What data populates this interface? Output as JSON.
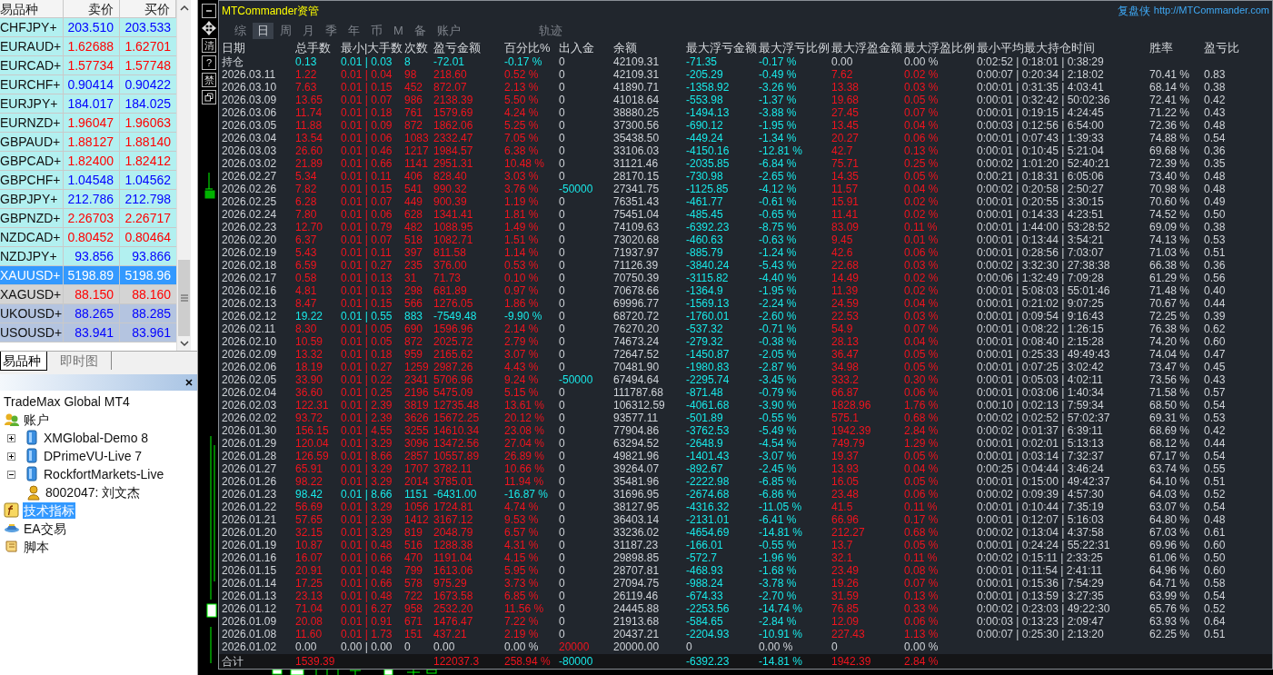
{
  "market_watch": {
    "columns": [
      "易品种",
      "卖价",
      "买价"
    ],
    "rows": [
      {
        "symbol": "CHFJPY+",
        "bid": "203.510",
        "ask": "203.533",
        "selected": false,
        "color": "#b2f0f0",
        "falling": false
      },
      {
        "symbol": "EURAUD+",
        "bid": "1.62688",
        "ask": "1.62701",
        "selected": false,
        "color": "#b2f0f0",
        "falling": true
      },
      {
        "symbol": "EURCAD+",
        "bid": "1.57734",
        "ask": "1.57748",
        "selected": false,
        "color": "#b2f0f0",
        "falling": true
      },
      {
        "symbol": "EURCHF+",
        "bid": "0.90414",
        "ask": "0.90422",
        "selected": false,
        "color": "#b2f0f0",
        "falling": false
      },
      {
        "symbol": "EURJPY+",
        "bid": "184.017",
        "ask": "184.025",
        "selected": false,
        "color": "#b2f0f0",
        "falling": false
      },
      {
        "symbol": "EURNZD+",
        "bid": "1.96047",
        "ask": "1.96063",
        "selected": false,
        "color": "#b2f0f0",
        "falling": true
      },
      {
        "symbol": "GBPAUD+",
        "bid": "1.88127",
        "ask": "1.88140",
        "selected": false,
        "color": "#b2f0f0",
        "falling": true
      },
      {
        "symbol": "GBPCAD+",
        "bid": "1.82400",
        "ask": "1.82412",
        "selected": false,
        "color": "#b2f0f0",
        "falling": true
      },
      {
        "symbol": "GBPCHF+",
        "bid": "1.04548",
        "ask": "1.04562",
        "selected": false,
        "color": "#b2f0f0",
        "falling": false
      },
      {
        "symbol": "GBPJPY+",
        "bid": "212.786",
        "ask": "212.798",
        "selected": false,
        "color": "#b2f0f0",
        "falling": false
      },
      {
        "symbol": "GBPNZD+",
        "bid": "2.26703",
        "ask": "2.26717",
        "selected": false,
        "color": "#b2f0f0",
        "falling": true
      },
      {
        "symbol": "NZDCAD+",
        "bid": "0.80452",
        "ask": "0.80464",
        "selected": false,
        "color": "#b2f0f0",
        "falling": true
      },
      {
        "symbol": "NZDJPY+",
        "bid": "93.856",
        "ask": "93.866",
        "selected": false,
        "color": "#b2f0f0",
        "falling": false
      },
      {
        "symbol": "XAUUSD+",
        "bid": "5198.89",
        "ask": "5198.96",
        "selected": true,
        "color": "#3399ff"
      },
      {
        "symbol": "XAGUSD+",
        "bid": "88.150",
        "ask": "88.160",
        "selected": false,
        "color": "#d4d4d4",
        "falling": true
      },
      {
        "symbol": "UKOUSD+",
        "bid": "88.265",
        "ask": "88.285",
        "selected": false,
        "color": "#b4c4e0",
        "falling": false
      },
      {
        "symbol": "USOUSD+",
        "bid": "83.941",
        "ask": "83.961",
        "selected": false,
        "color": "#b4c4e0",
        "falling": false
      }
    ],
    "tabs": [
      {
        "label": "易品种",
        "selected": true
      },
      {
        "label": "即时图",
        "selected": false
      }
    ]
  },
  "navigator": {
    "root": "TradeMax Global MT4",
    "items": [
      {
        "label": "账户",
        "kind": "accounts",
        "selected": false,
        "children": [
          {
            "label": "XMGlobal-Demo 8",
            "kind": "server",
            "expanded": false
          },
          {
            "label": "DPrimeVU-Live 7",
            "kind": "server",
            "expanded": false
          },
          {
            "label": "RockfortMarkets-Live",
            "kind": "server",
            "expanded": true,
            "children": [
              {
                "label": "8002047: 刘文杰",
                "kind": "user"
              }
            ]
          }
        ]
      },
      {
        "label": "技术指标",
        "kind": "indicators",
        "selected": true
      },
      {
        "label": "EA交易",
        "kind": "experts",
        "selected": false
      },
      {
        "label": "脚本",
        "kind": "scripts",
        "selected": false
      }
    ]
  },
  "chart_buttons": [
    {
      "kind": "minimize"
    },
    {
      "kind": "move"
    },
    {
      "kind": "text",
      "label": "清"
    },
    {
      "kind": "text",
      "label": "?"
    },
    {
      "kind": "text",
      "label": "禁"
    },
    {
      "kind": "restore"
    }
  ],
  "panel": {
    "title": "MTCommander资管",
    "brand": "复盘侠",
    "link": "http://MTCommander.com",
    "tabs": [
      {
        "label": "综",
        "kind": "period",
        "selected": false
      },
      {
        "label": "日",
        "kind": "period",
        "selected": true
      },
      {
        "label": "周",
        "kind": "period",
        "selected": false
      },
      {
        "label": "月",
        "kind": "period",
        "selected": false
      },
      {
        "label": "季",
        "kind": "period",
        "selected": false
      },
      {
        "label": "年",
        "kind": "period",
        "selected": false
      },
      {
        "label": "币",
        "kind": "period",
        "selected": false
      },
      {
        "label": "M",
        "kind": "period",
        "selected": false
      },
      {
        "label": "备",
        "kind": "period",
        "selected": false
      },
      {
        "label": "账户",
        "kind": "period",
        "selected": false
      },
      {
        "label": "轨迹",
        "kind": "separate",
        "selected": false
      }
    ],
    "columns": [
      "日期",
      "总手数",
      "最小|大手数",
      "次数",
      "盈亏金额",
      "百分比%",
      "出入金",
      "余额",
      "最大浮亏金额",
      "最大浮亏比例",
      "最大浮盈金额",
      "最大浮盈比例",
      "最小平均最大持仓时间",
      "胜率",
      "盈亏比"
    ],
    "rows": [
      {
        "kind": "holding",
        "withdrawal": false,
        "deposit": false,
        "cells": [
          "持仓",
          "0.13",
          "0.01 | 0.03",
          "8",
          "-72.01",
          "-0.17 %",
          "0",
          "42109.31",
          "-71.35",
          "-0.17 %",
          "0.00",
          "0.00 %",
          "0:02:52 | 0:18:01 | 0:38:29"
        ]
      },
      {
        "kind": "profit",
        "withdrawal": false,
        "deposit": false,
        "cells": [
          "2026.03.11",
          "1.22",
          "0.01 | 0.04",
          "98",
          "218.60",
          "0.52 %",
          "0",
          "42109.31",
          "-205.29",
          "-0.49 %",
          "7.62",
          "0.02 %",
          "0:00:07 | 0:20:34 | 2:18:02",
          "70.41 %",
          "0.83"
        ]
      },
      {
        "kind": "profit",
        "withdrawal": false,
        "deposit": false,
        "cells": [
          "2026.03.10",
          "7.63",
          "0.01 | 0.15",
          "452",
          "872.07",
          "2.13 %",
          "0",
          "41890.71",
          "-1358.92",
          "-3.26 %",
          "13.38",
          "0.03 %",
          "0:00:01 | 0:31:35 | 4:03:41",
          "68.14 %",
          "0.38"
        ]
      },
      {
        "kind": "profit",
        "withdrawal": false,
        "deposit": false,
        "cells": [
          "2026.03.09",
          "13.65",
          "0.01 | 0.07",
          "986",
          "2138.39",
          "5.50 %",
          "0",
          "41018.64",
          "-553.98",
          "-1.37 %",
          "19.68",
          "0.05 %",
          "0:00:01 | 0:32:42 | 50:02:36",
          "72.41 %",
          "0.42"
        ]
      },
      {
        "kind": "profit",
        "withdrawal": false,
        "deposit": false,
        "cells": [
          "2026.03.06",
          "11.74",
          "0.01 | 0.18",
          "761",
          "1579.69",
          "4.24 %",
          "0",
          "38880.25",
          "-1494.13",
          "-3.88 %",
          "27.45",
          "0.07 %",
          "0:00:01 | 0:19:15 | 4:24:45",
          "71.22 %",
          "0.43"
        ]
      },
      {
        "kind": "profit",
        "withdrawal": false,
        "deposit": false,
        "cells": [
          "2026.03.05",
          "11.88",
          "0.01 | 0.09",
          "872",
          "1862.06",
          "5.25 %",
          "0",
          "37300.56",
          "-690.12",
          "-1.95 %",
          "13.45",
          "0.04 %",
          "0:00:03 | 0:12:56 | 6:54:00",
          "72.36 %",
          "0.48"
        ]
      },
      {
        "kind": "profit",
        "withdrawal": false,
        "deposit": false,
        "cells": [
          "2026.03.04",
          "13.54",
          "0.01 | 0.06",
          "1083",
          "2332.47",
          "7.05 %",
          "0",
          "35438.50",
          "-449.24",
          "-1.34 %",
          "20.27",
          "0.06 %",
          "0:00:01 | 0:07:43 | 1:39:33",
          "74.88 %",
          "0.54"
        ]
      },
      {
        "kind": "profit",
        "withdrawal": false,
        "deposit": false,
        "cells": [
          "2026.03.03",
          "26.60",
          "0.01 | 0.46",
          "1217",
          "1984.57",
          "6.38 %",
          "0",
          "33106.03",
          "-4150.16",
          "-12.81 %",
          "42.7",
          "0.13 %",
          "0:00:01 | 0:10:45 | 5:21:04",
          "69.68 %",
          "0.36"
        ]
      },
      {
        "kind": "profit",
        "withdrawal": false,
        "deposit": false,
        "cells": [
          "2026.03.02",
          "21.89",
          "0.01 | 0.66",
          "1141",
          "2951.31",
          "10.48 %",
          "0",
          "31121.46",
          "-2035.85",
          "-6.84 %",
          "75.71",
          "0.25 %",
          "0:00:02 | 1:01:20 | 52:40:21",
          "72.39 %",
          "0.35"
        ]
      },
      {
        "kind": "profit",
        "withdrawal": false,
        "deposit": false,
        "cells": [
          "2026.02.27",
          "5.34",
          "0.01 | 0.11",
          "406",
          "828.40",
          "3.03 %",
          "0",
          "28170.15",
          "-730.98",
          "-2.65 %",
          "14.35",
          "0.05 %",
          "0:00:21 | 0:18:31 | 6:05:06",
          "73.40 %",
          "0.48"
        ]
      },
      {
        "kind": "profit",
        "withdrawal": true,
        "deposit": false,
        "cells": [
          "2026.02.26",
          "7.82",
          "0.01 | 0.15",
          "541",
          "990.32",
          "3.76 %",
          "-50000",
          "27341.75",
          "-1125.85",
          "-4.12 %",
          "11.57",
          "0.04 %",
          "0:00:02 | 0:20:58 | 2:50:27",
          "70.98 %",
          "0.48"
        ]
      },
      {
        "kind": "profit",
        "withdrawal": false,
        "deposit": false,
        "cells": [
          "2026.02.25",
          "6.28",
          "0.01 | 0.07",
          "449",
          "900.39",
          "1.19 %",
          "0",
          "76351.43",
          "-461.77",
          "-0.61 %",
          "15.91",
          "0.02 %",
          "0:00:01 | 0:20:55 | 3:30:15",
          "70.60 %",
          "0.49"
        ]
      },
      {
        "kind": "profit",
        "withdrawal": false,
        "deposit": false,
        "cells": [
          "2026.02.24",
          "7.80",
          "0.01 | 0.06",
          "628",
          "1341.41",
          "1.81 %",
          "0",
          "75451.04",
          "-485.45",
          "-0.65 %",
          "11.41",
          "0.02 %",
          "0:00:01 | 0:14:33 | 4:23:51",
          "74.52 %",
          "0.50"
        ]
      },
      {
        "kind": "profit",
        "withdrawal": false,
        "deposit": false,
        "cells": [
          "2026.02.23",
          "12.70",
          "0.01 | 0.79",
          "482",
          "1088.95",
          "1.49 %",
          "0",
          "74109.63",
          "-6392.23",
          "-8.75 %",
          "83.09",
          "0.11 %",
          "0:00:01 | 1:44:00 | 53:28:52",
          "69.09 %",
          "0.38"
        ]
      },
      {
        "kind": "profit",
        "withdrawal": false,
        "deposit": false,
        "cells": [
          "2026.02.20",
          "6.37",
          "0.01 | 0.07",
          "518",
          "1082.71",
          "1.51 %",
          "0",
          "73020.68",
          "-460.63",
          "-0.63 %",
          "9.45",
          "0.01 %",
          "0:00:01 | 0:13:44 | 3:54:21",
          "74.13 %",
          "0.53"
        ]
      },
      {
        "kind": "profit",
        "withdrawal": false,
        "deposit": false,
        "cells": [
          "2026.02.19",
          "5.43",
          "0.01 | 0.11",
          "397",
          "811.58",
          "1.14 %",
          "0",
          "71937.97",
          "-885.79",
          "-1.24 %",
          "42.6",
          "0.06 %",
          "0:00:01 | 0:28:56 | 7:03:07",
          "71.03 %",
          "0.51"
        ]
      },
      {
        "kind": "profit",
        "withdrawal": false,
        "deposit": false,
        "cells": [
          "2026.02.18",
          "6.59",
          "0.01 | 0.27",
          "235",
          "376.00",
          "0.53 %",
          "0",
          "71126.39",
          "-3840.24",
          "-5.43 %",
          "22.68",
          "0.03 %",
          "0:00:02 | 3:32:30 | 27:38:38",
          "66.38 %",
          "0.36"
        ]
      },
      {
        "kind": "profit",
        "withdrawal": false,
        "deposit": false,
        "cells": [
          "2026.02.17",
          "0.58",
          "0.01 | 0.13",
          "31",
          "71.73",
          "0.10 %",
          "0",
          "70750.39",
          "-3115.82",
          "-4.40 %",
          "14.49",
          "0.02 %",
          "0:00:06 | 1:32:49 | 7:09:28",
          "61.29 %",
          "0.56"
        ]
      },
      {
        "kind": "profit",
        "withdrawal": false,
        "deposit": false,
        "cells": [
          "2026.02.16",
          "4.81",
          "0.01 | 0.13",
          "298",
          "681.89",
          "0.97 %",
          "0",
          "70678.66",
          "-1364.9",
          "-1.95 %",
          "11.39",
          "0.02 %",
          "0:00:01 | 5:08:03 | 55:01:46",
          "71.48 %",
          "0.40"
        ]
      },
      {
        "kind": "profit",
        "withdrawal": false,
        "deposit": false,
        "cells": [
          "2026.02.13",
          "8.47",
          "0.01 | 0.15",
          "566",
          "1276.05",
          "1.86 %",
          "0",
          "69996.77",
          "-1569.13",
          "-2.24 %",
          "24.59",
          "0.04 %",
          "0:00:01 | 0:21:02 | 9:07:25",
          "70.67 %",
          "0.44"
        ]
      },
      {
        "kind": "loss",
        "withdrawal": false,
        "deposit": false,
        "cells": [
          "2026.02.12",
          "19.22",
          "0.01 | 0.55",
          "883",
          "-7549.48",
          "-9.90 %",
          "0",
          "68720.72",
          "-1760.01",
          "-2.60 %",
          "22.53",
          "0.03 %",
          "0:00:01 | 0:09:54 | 9:16:43",
          "72.25 %",
          "0.39"
        ]
      },
      {
        "kind": "profit",
        "withdrawal": false,
        "deposit": false,
        "cells": [
          "2026.02.11",
          "8.30",
          "0.01 | 0.05",
          "690",
          "1596.96",
          "2.14 %",
          "0",
          "76270.20",
          "-537.32",
          "-0.71 %",
          "54.9",
          "0.07 %",
          "0:00:01 | 0:08:22 | 1:26:15",
          "76.38 %",
          "0.62"
        ]
      },
      {
        "kind": "profit",
        "withdrawal": false,
        "deposit": false,
        "cells": [
          "2026.02.10",
          "10.59",
          "0.01 | 0.05",
          "872",
          "2025.72",
          "2.79 %",
          "0",
          "74673.24",
          "-279.32",
          "-0.38 %",
          "28.13",
          "0.04 %",
          "0:00:01 | 0:08:40 | 2:15:28",
          "74.20 %",
          "0.60"
        ]
      },
      {
        "kind": "profit",
        "withdrawal": false,
        "deposit": false,
        "cells": [
          "2026.02.09",
          "13.32",
          "0.01 | 0.18",
          "959",
          "2165.62",
          "3.07 %",
          "0",
          "72647.52",
          "-1450.87",
          "-2.05 %",
          "36.47",
          "0.05 %",
          "0:00:01 | 0:25:33 | 49:49:43",
          "74.04 %",
          "0.47"
        ]
      },
      {
        "kind": "profit",
        "withdrawal": false,
        "deposit": false,
        "cells": [
          "2026.02.06",
          "18.19",
          "0.01 | 0.27",
          "1259",
          "2987.26",
          "4.43 %",
          "0",
          "70481.90",
          "-1980.83",
          "-2.87 %",
          "34.98",
          "0.05 %",
          "0:00:01 | 0:07:25 | 3:02:42",
          "73.47 %",
          "0.45"
        ]
      },
      {
        "kind": "profit",
        "withdrawal": true,
        "deposit": false,
        "cells": [
          "2026.02.05",
          "33.90",
          "0.01 | 0.22",
          "2341",
          "5706.96",
          "9.24 %",
          "-50000",
          "67494.64",
          "-2295.74",
          "-3.45 %",
          "333.2",
          "0.30 %",
          "0:00:01 | 0:05:03 | 4:02:11",
          "73.56 %",
          "0.43"
        ]
      },
      {
        "kind": "profit",
        "withdrawal": false,
        "deposit": false,
        "cells": [
          "2026.02.04",
          "36.60",
          "0.01 | 0.25",
          "2196",
          "5475.09",
          "5.15 %",
          "0",
          "111787.68",
          "-871.48",
          "-0.79 %",
          "66.87",
          "0.06 %",
          "0:00:01 | 0:03:06 | 1:40:34",
          "71.58 %",
          "0.57"
        ]
      },
      {
        "kind": "profit",
        "withdrawal": false,
        "deposit": false,
        "cells": [
          "2026.02.03",
          "122.31",
          "0.01 | 2.39",
          "3819",
          "12735.48",
          "13.61 %",
          "0",
          "106312.59",
          "-4061.68",
          "-3.90 %",
          "1828.96",
          "1.76 %",
          "0:00:10 | 0:02:13 | 7:59:34",
          "68.50 %",
          "0.54"
        ]
      },
      {
        "kind": "profit",
        "withdrawal": false,
        "deposit": false,
        "cells": [
          "2026.02.02",
          "93.72",
          "0.01 | 2.39",
          "3626",
          "15672.25",
          "20.12 %",
          "0",
          "93577.11",
          "-501.89",
          "-0.55 %",
          "575.1",
          "0.68 %",
          "0:00:02 | 0:02:52 | 57:02:37",
          "69.31 %",
          "0.53"
        ]
      },
      {
        "kind": "profit",
        "withdrawal": false,
        "deposit": false,
        "cells": [
          "2026.01.30",
          "156.15",
          "0.01 | 4.55",
          "3255",
          "14610.34",
          "23.08 %",
          "0",
          "77904.86",
          "-3762.53",
          "-5.49 %",
          "1942.39",
          "2.84 %",
          "0:00:02 | 0:01:37 | 6:39:11",
          "68.69 %",
          "0.42"
        ]
      },
      {
        "kind": "profit",
        "withdrawal": false,
        "deposit": false,
        "cells": [
          "2026.01.29",
          "120.04",
          "0.01 | 3.29",
          "3096",
          "13472.56",
          "27.04 %",
          "0",
          "63294.52",
          "-2648.9",
          "-4.54 %",
          "749.79",
          "1.29 %",
          "0:00:01 | 0:02:01 | 5:13:13",
          "68.12 %",
          "0.44"
        ]
      },
      {
        "kind": "profit",
        "withdrawal": false,
        "deposit": false,
        "cells": [
          "2026.01.28",
          "126.59",
          "0.01 | 8.66",
          "2857",
          "10557.89",
          "26.89 %",
          "0",
          "49821.96",
          "-1401.43",
          "-3.07 %",
          "19.37",
          "0.05 %",
          "0:00:01 | 0:03:14 | 7:32:37",
          "67.17 %",
          "0.54"
        ]
      },
      {
        "kind": "profit",
        "withdrawal": false,
        "deposit": false,
        "cells": [
          "2026.01.27",
          "65.91",
          "0.01 | 3.29",
          "1707",
          "3782.11",
          "10.66 %",
          "0",
          "39264.07",
          "-892.67",
          "-2.45 %",
          "13.93",
          "0.04 %",
          "0:00:25 | 0:04:44 | 3:46:24",
          "63.74 %",
          "0.55"
        ]
      },
      {
        "kind": "profit",
        "withdrawal": false,
        "deposit": false,
        "cells": [
          "2026.01.26",
          "98.22",
          "0.01 | 3.29",
          "2014",
          "3785.01",
          "11.94 %",
          "0",
          "35481.96",
          "-2222.98",
          "-6.85 %",
          "16.05",
          "0.05 %",
          "0:00:01 | 0:15:00 | 49:42:37",
          "64.10 %",
          "0.51"
        ]
      },
      {
        "kind": "loss",
        "withdrawal": false,
        "deposit": false,
        "cells": [
          "2026.01.23",
          "98.42",
          "0.01 | 8.66",
          "1151",
          "-6431.00",
          "-16.87 %",
          "0",
          "31696.95",
          "-2674.68",
          "-6.86 %",
          "23.48",
          "0.06 %",
          "0:00:02 | 0:09:39 | 4:57:30",
          "64.03 %",
          "0.52"
        ]
      },
      {
        "kind": "profit",
        "withdrawal": false,
        "deposit": false,
        "cells": [
          "2026.01.22",
          "56.69",
          "0.01 | 3.29",
          "1056",
          "1724.81",
          "4.74 %",
          "0",
          "38127.95",
          "-4316.32",
          "-11.05 %",
          "41.5",
          "0.11 %",
          "0:00:01 | 0:10:44 | 7:35:19",
          "63.07 %",
          "0.54"
        ]
      },
      {
        "kind": "profit",
        "withdrawal": false,
        "deposit": false,
        "cells": [
          "2026.01.21",
          "57.65",
          "0.01 | 2.39",
          "1412",
          "3167.12",
          "9.53 %",
          "0",
          "36403.14",
          "-2131.01",
          "-6.41 %",
          "66.96",
          "0.17 %",
          "0:00:01 | 0:12:07 | 5:16:03",
          "64.80 %",
          "0.48"
        ]
      },
      {
        "kind": "profit",
        "withdrawal": false,
        "deposit": false,
        "cells": [
          "2026.01.20",
          "32.15",
          "0.01 | 3.29",
          "819",
          "2048.79",
          "6.57 %",
          "0",
          "33236.02",
          "-4654.69",
          "-14.81 %",
          "212.27",
          "0.68 %",
          "0:00:02 | 0:13:04 | 4:37:58",
          "67.03 %",
          "0.61"
        ]
      },
      {
        "kind": "profit",
        "withdrawal": false,
        "deposit": false,
        "cells": [
          "2026.01.19",
          "10.87",
          "0.01 | 0.48",
          "516",
          "1288.38",
          "4.31 %",
          "0",
          "31187.23",
          "-166.01",
          "-0.55 %",
          "13.7",
          "0.05 %",
          "0:00:01 | 0:24:24 | 55:22:31",
          "69.96 %",
          "0.60"
        ]
      },
      {
        "kind": "profit",
        "withdrawal": false,
        "deposit": false,
        "cells": [
          "2026.01.16",
          "16.07",
          "0.01 | 0.66",
          "470",
          "1191.04",
          "4.15 %",
          "0",
          "29898.85",
          "-572.7",
          "-1.96 %",
          "32.1",
          "0.11 %",
          "0:00:02 | 0:15:11 | 2:33:25",
          "61.06 %",
          "0.50"
        ]
      },
      {
        "kind": "profit",
        "withdrawal": false,
        "deposit": false,
        "cells": [
          "2026.01.15",
          "20.91",
          "0.01 | 0.48",
          "799",
          "1613.06",
          "5.95 %",
          "0",
          "28707.81",
          "-468.93",
          "-1.68 %",
          "23.49",
          "0.08 %",
          "0:00:01 | 0:11:54 | 2:41:11",
          "64.96 %",
          "0.60"
        ]
      },
      {
        "kind": "profit",
        "withdrawal": false,
        "deposit": false,
        "cells": [
          "2026.01.14",
          "17.25",
          "0.01 | 0.66",
          "578",
          "975.29",
          "3.73 %",
          "0",
          "27094.75",
          "-988.24",
          "-3.78 %",
          "19.26",
          "0.07 %",
          "0:00:01 | 0:15:36 | 7:54:29",
          "64.71 %",
          "0.58"
        ]
      },
      {
        "kind": "profit",
        "withdrawal": false,
        "deposit": false,
        "cells": [
          "2026.01.13",
          "23.13",
          "0.01 | 0.48",
          "722",
          "1673.58",
          "6.85 %",
          "0",
          "26119.46",
          "-674.33",
          "-2.70 %",
          "31.59",
          "0.13 %",
          "0:00:01 | 0:13:59 | 3:27:35",
          "63.99 %",
          "0.54"
        ]
      },
      {
        "kind": "profit",
        "withdrawal": false,
        "deposit": false,
        "cells": [
          "2026.01.12",
          "71.04",
          "0.01 | 6.27",
          "958",
          "2532.20",
          "11.56 %",
          "0",
          "24445.88",
          "-2253.56",
          "-14.74 %",
          "76.85",
          "0.33 %",
          "0:00:02 | 0:23:03 | 49:22:30",
          "65.76 %",
          "0.52"
        ]
      },
      {
        "kind": "profit",
        "withdrawal": false,
        "deposit": false,
        "cells": [
          "2026.01.09",
          "20.08",
          "0.01 | 0.91",
          "671",
          "1476.47",
          "7.22 %",
          "0",
          "21913.68",
          "-584.65",
          "-2.84 %",
          "12.09",
          "0.06 %",
          "0:00:03 | 0:13:23 | 2:09:47",
          "63.93 %",
          "0.64"
        ]
      },
      {
        "kind": "profit",
        "withdrawal": false,
        "deposit": false,
        "cells": [
          "2026.01.08",
          "11.60",
          "0.01 | 1.73",
          "151",
          "437.21",
          "2.19 %",
          "0",
          "20437.21",
          "-2204.93",
          "-10.91 %",
          "227.43",
          "1.13 %",
          "0:00:07 | 0:25:30 | 2:13:20",
          "62.25 %",
          "0.51"
        ]
      },
      {
        "kind": "empty",
        "withdrawal": false,
        "deposit": true,
        "cells": [
          "2026.01.02",
          "0.00",
          "0.00 | 0.00",
          "0",
          "0.00",
          "0.00 %",
          "20000",
          "20000.00",
          "0",
          "0.00 %",
          "0",
          "0.00 %"
        ]
      }
    ],
    "totals": {
      "label": "合计",
      "total_lots": "1539.39",
      "pnl": "122037.3",
      "percent": "258.94 %",
      "inout": "-80000",
      "max_float_loss": "-6392.23",
      "max_float_loss_pct": "-14.81 %",
      "max_float_gain": "1942.39",
      "max_float_gain_pct": "2.84 %"
    }
  }
}
